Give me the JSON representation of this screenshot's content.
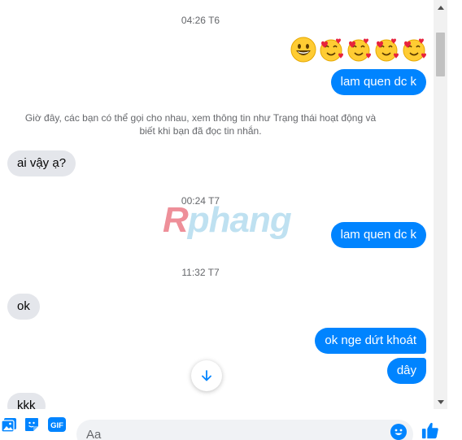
{
  "chat": {
    "timestamps": [
      "04:26 T6",
      "00:24 T7",
      "11:32 T7"
    ],
    "system_notice_line1": "Giờ đây, các bạn có thể gọi cho nhau, xem thông tin như Trạng thái hoạt động và",
    "system_notice_line2": "biết khi bạn đã đọc tin nhắn.",
    "emoji_icons": [
      "grinning-face-icon",
      "smiling-face-with-hearts-icon",
      "smiling-face-with-hearts-icon",
      "smiling-face-with-hearts-icon",
      "smiling-face-with-hearts-icon"
    ],
    "messages": {
      "out_1": "lam quen dc k",
      "in_1": "ai vậy ạ?",
      "out_2": "lam quen dc k",
      "in_2": "ok",
      "out_3": "ok nge dứt khoát",
      "out_4": "dây",
      "in_3": "kkk"
    }
  },
  "watermark": {
    "r": "R",
    "rest": "phang"
  },
  "composer": {
    "placeholder": "Aa"
  },
  "colors": {
    "outgoing": "#0084ff",
    "incoming": "#e4e6eb",
    "meta_text": "#65676b"
  }
}
